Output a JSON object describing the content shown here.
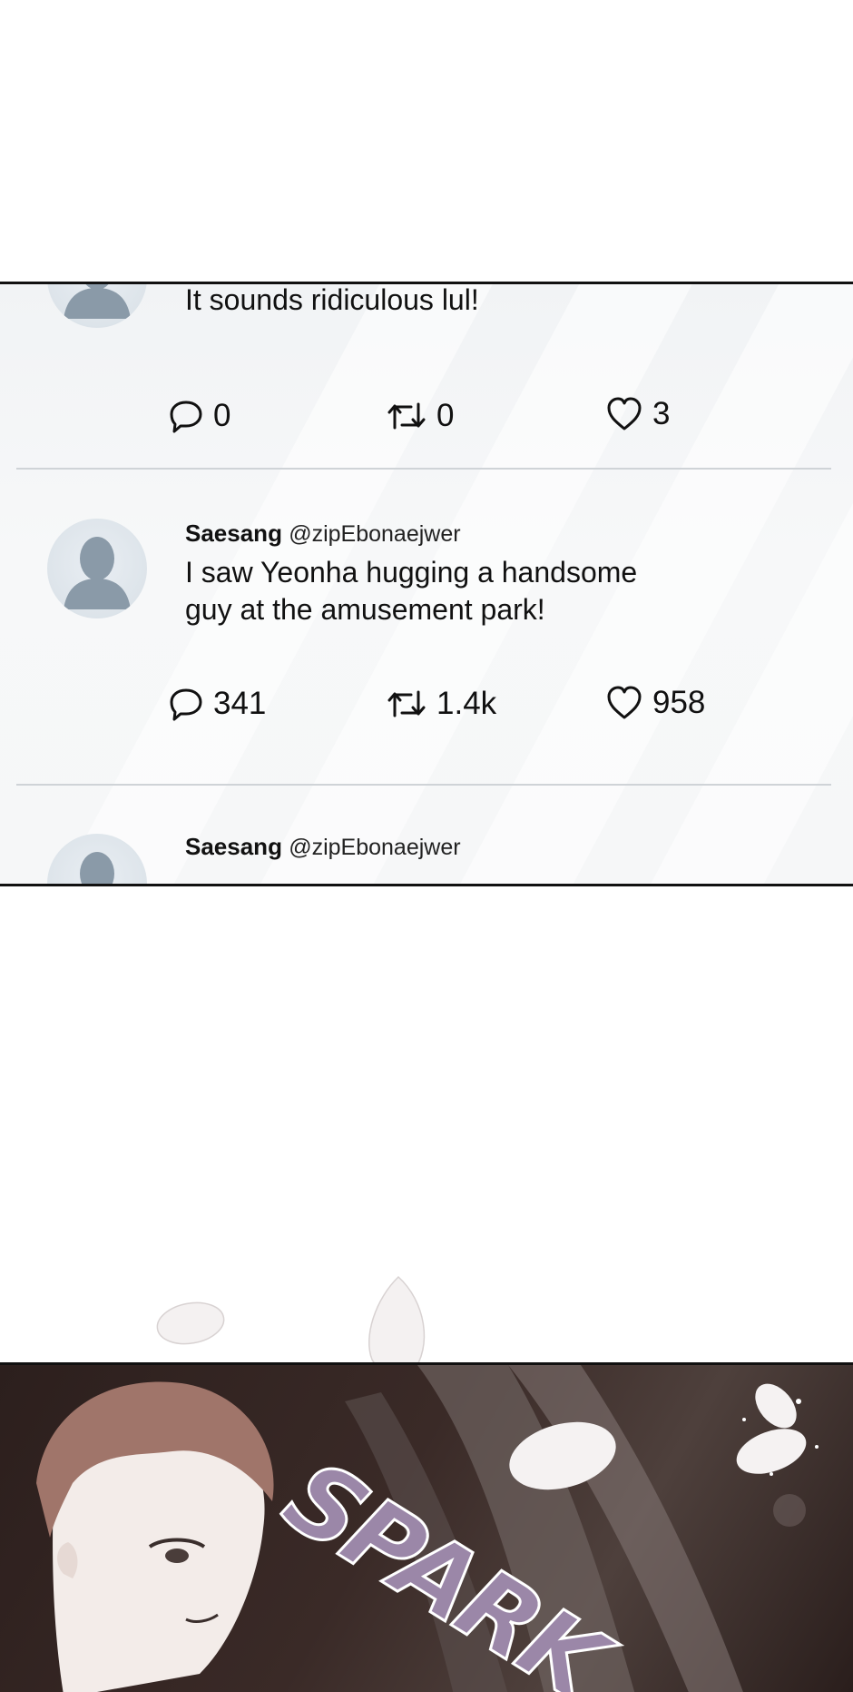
{
  "feed": {
    "tweets": [
      {
        "text_lines": [
          "It sounds ridiculous lul!"
        ],
        "replies": "0",
        "retweets": "0",
        "likes": "3"
      },
      {
        "name": "Saesang",
        "handle": "@zipEbonaejwer",
        "text_lines": [
          "I saw Yeonha hugging a handsome",
          "guy at the amusement park!"
        ],
        "replies": "341",
        "retweets": "1.4k",
        "likes": "958"
      },
      {
        "name": "Saesang",
        "handle": "@zipEbonaejwer"
      }
    ]
  },
  "comic": {
    "sound_effect": "SPARK"
  },
  "icons": {
    "reply": "speech-bubble-icon",
    "retweet": "retweet-arrows-icon",
    "like": "heart-icon",
    "avatar": "default-user-silhouette"
  },
  "colors": {
    "panel_bg": "#f3f5f7",
    "text": "#111111",
    "avatar_silhouette": "#8a9aa8",
    "divider": "#cfd3d7",
    "sfx": "#9b87a8"
  }
}
